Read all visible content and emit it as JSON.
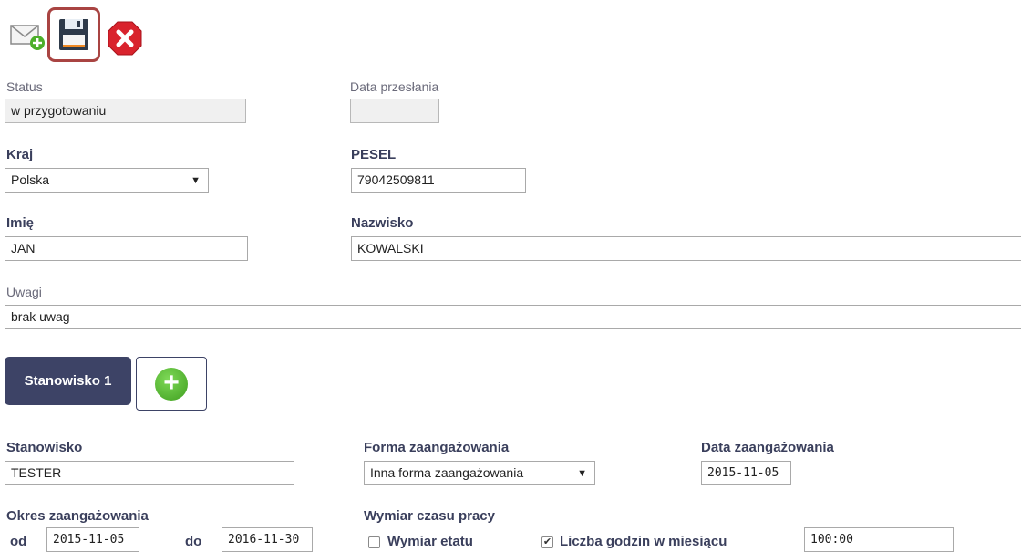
{
  "toolbar": {
    "new_message_icon": "envelope-add-icon",
    "save_icon": "floppy-disk-icon",
    "cancel_icon": "close-octagon-icon",
    "colors": {
      "highlight": "#a94442",
      "cancel": "#d9232d",
      "add": "#4caf2a"
    }
  },
  "status": {
    "label": "Status",
    "value": "w przygotowaniu"
  },
  "data_przeslania": {
    "label": "Data przesłania",
    "value": ""
  },
  "kraj": {
    "label": "Kraj",
    "value": "Polska"
  },
  "pesel": {
    "label": "PESEL",
    "value": "79042509811"
  },
  "imie": {
    "label": "Imię",
    "value": "JAN"
  },
  "nazwisko": {
    "label": "Nazwisko",
    "value": "KOWALSKI"
  },
  "uwagi": {
    "label": "Uwagi",
    "value": "brak uwag"
  },
  "tabs": {
    "active_label": "Stanowisko 1",
    "add_icon": "plus-circle-icon"
  },
  "stanowisko": {
    "label": "Stanowisko",
    "value": "TESTER"
  },
  "forma": {
    "label": "Forma zaangażowania",
    "value": "Inna forma zaangażowania"
  },
  "data_zaangazowania": {
    "label": "Data zaangażowania",
    "value": "2015-11-05"
  },
  "okres": {
    "label": "Okres zaangażowania",
    "od_label": "od",
    "od_value": "2015-11-05",
    "do_label": "do",
    "do_value": "2016-11-30"
  },
  "wymiar": {
    "label": "Wymiar czasu pracy",
    "etat_label": "Wymiar etatu",
    "etat_checked": false,
    "godziny_label": "Liczba godzin w miesiącu",
    "godziny_checked": true,
    "godziny_value": "100:00"
  }
}
